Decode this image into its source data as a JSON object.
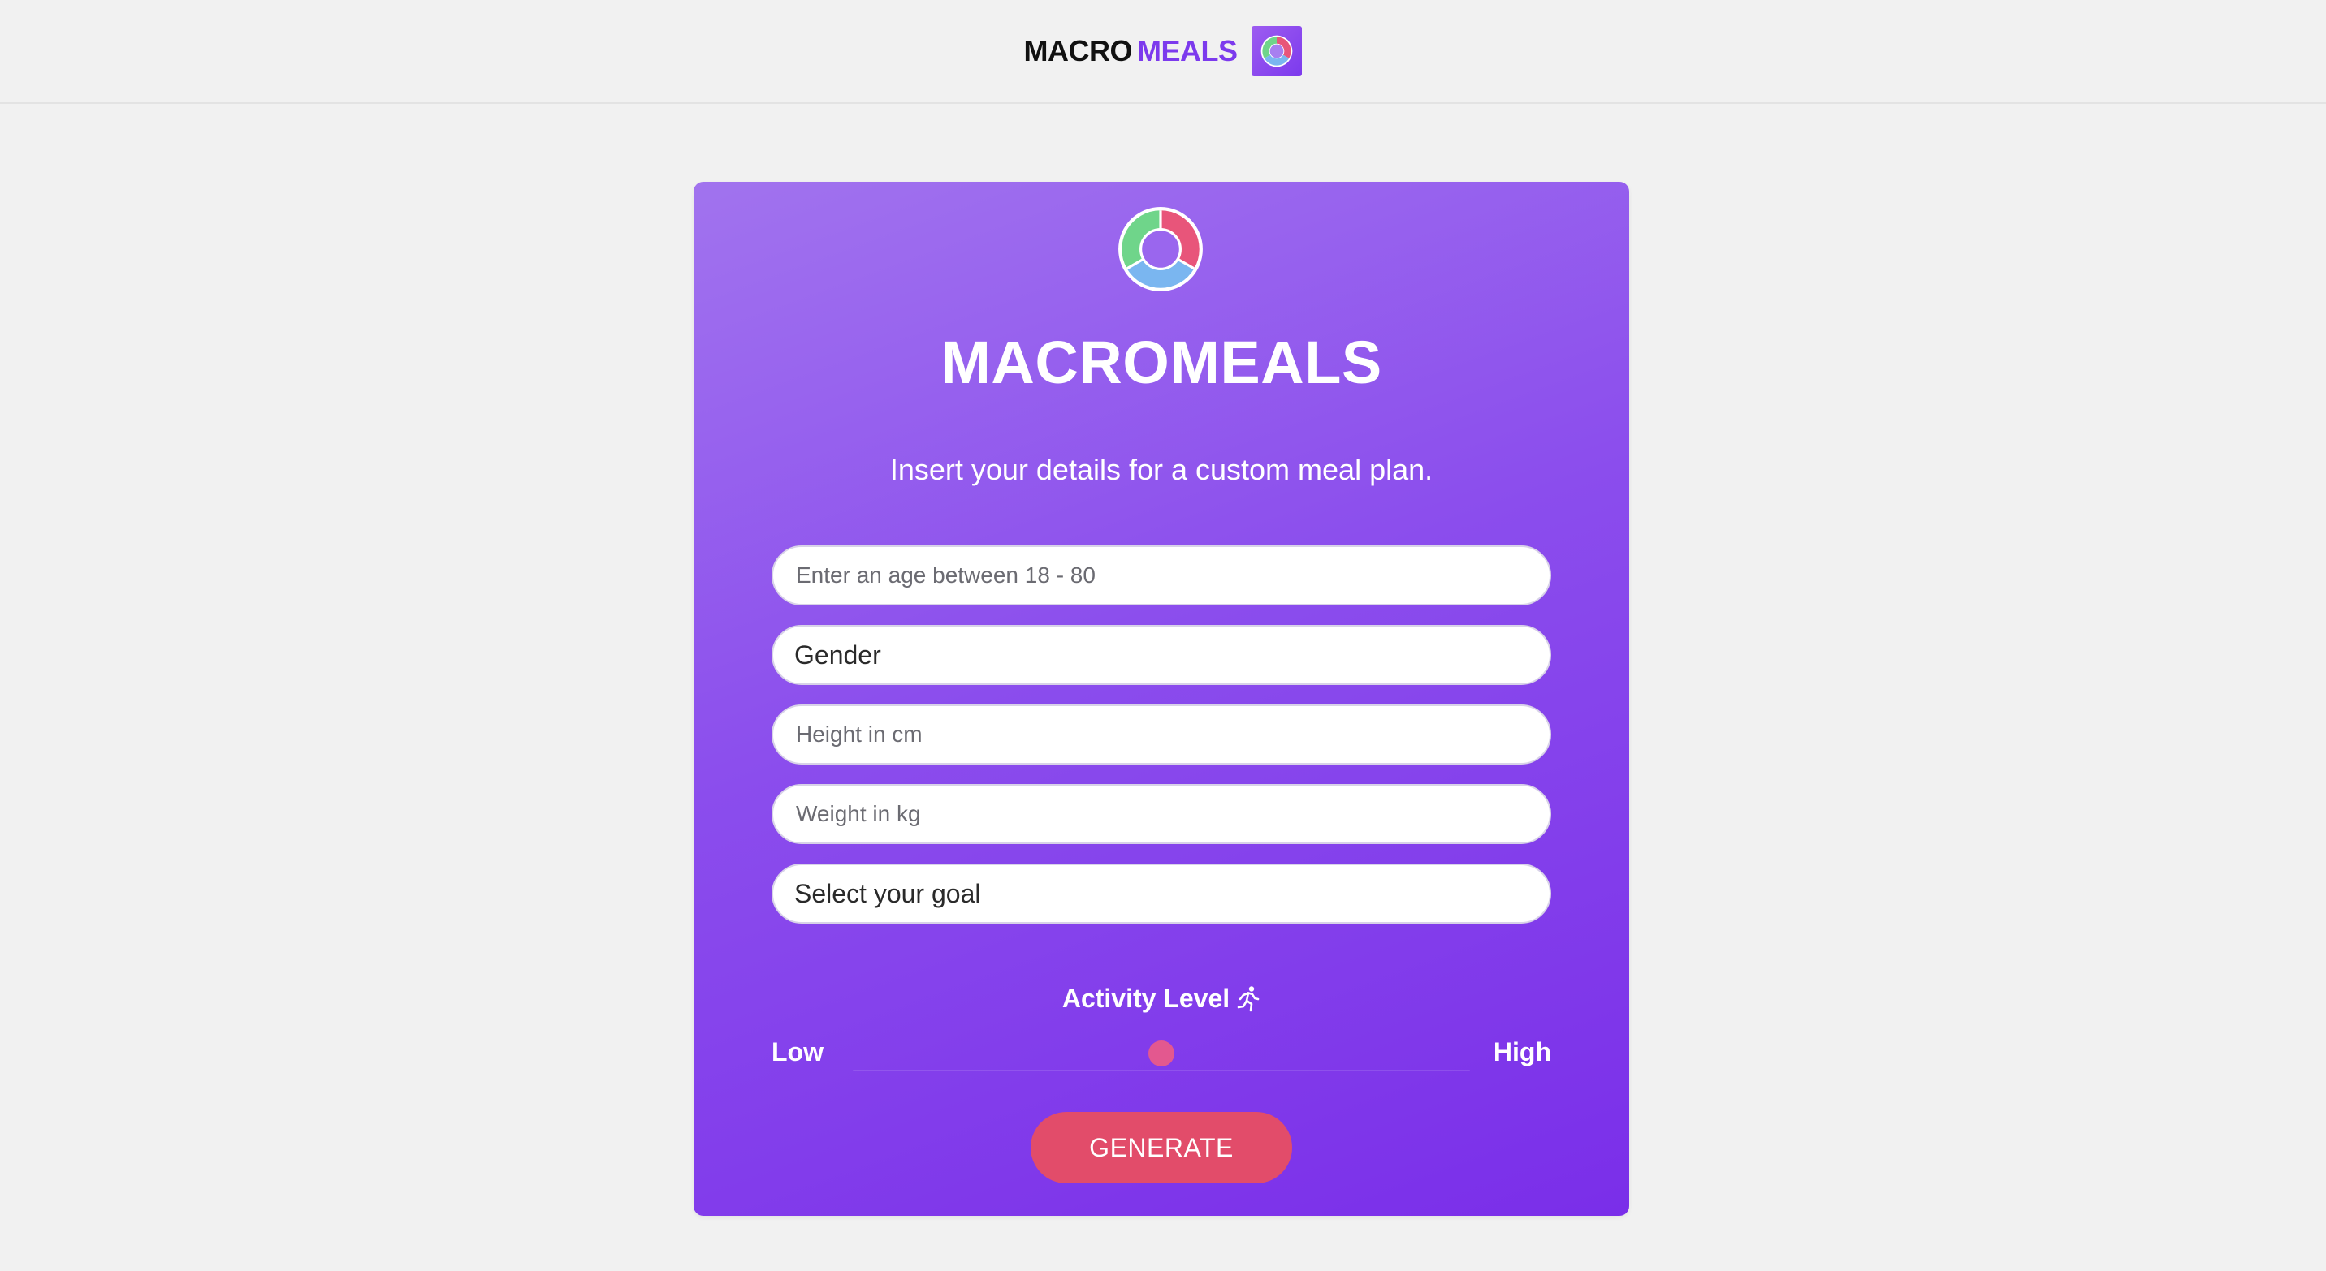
{
  "header": {
    "brand_macro": "MACRO",
    "brand_meals": "MEALS",
    "logo_icon": "donut-chart-logo-icon"
  },
  "card": {
    "logo_icon": "donut-chart-logo-icon",
    "title": "MACROMEALS",
    "subtitle": "Insert your details for a custom meal plan."
  },
  "form": {
    "age_placeholder": "Enter an age between 18 - 80",
    "gender_value": "Gender",
    "height_placeholder": "Height in cm",
    "weight_placeholder": "Weight in kg",
    "goal_value": "Select your goal"
  },
  "activity": {
    "label": "Activity Level",
    "icon": "running-person-icon",
    "low_label": "Low",
    "high_label": "High",
    "level": 0.5
  },
  "actions": {
    "generate_label": "GENERATE"
  },
  "colors": {
    "brand_purple": "#7c3aed",
    "card_gradient_start": "#a173ee",
    "card_gradient_end": "#7a2ee9",
    "button_red": "#e24c6a",
    "slider_thumb": "#e3588f",
    "page_background": "#f1f1f1"
  }
}
